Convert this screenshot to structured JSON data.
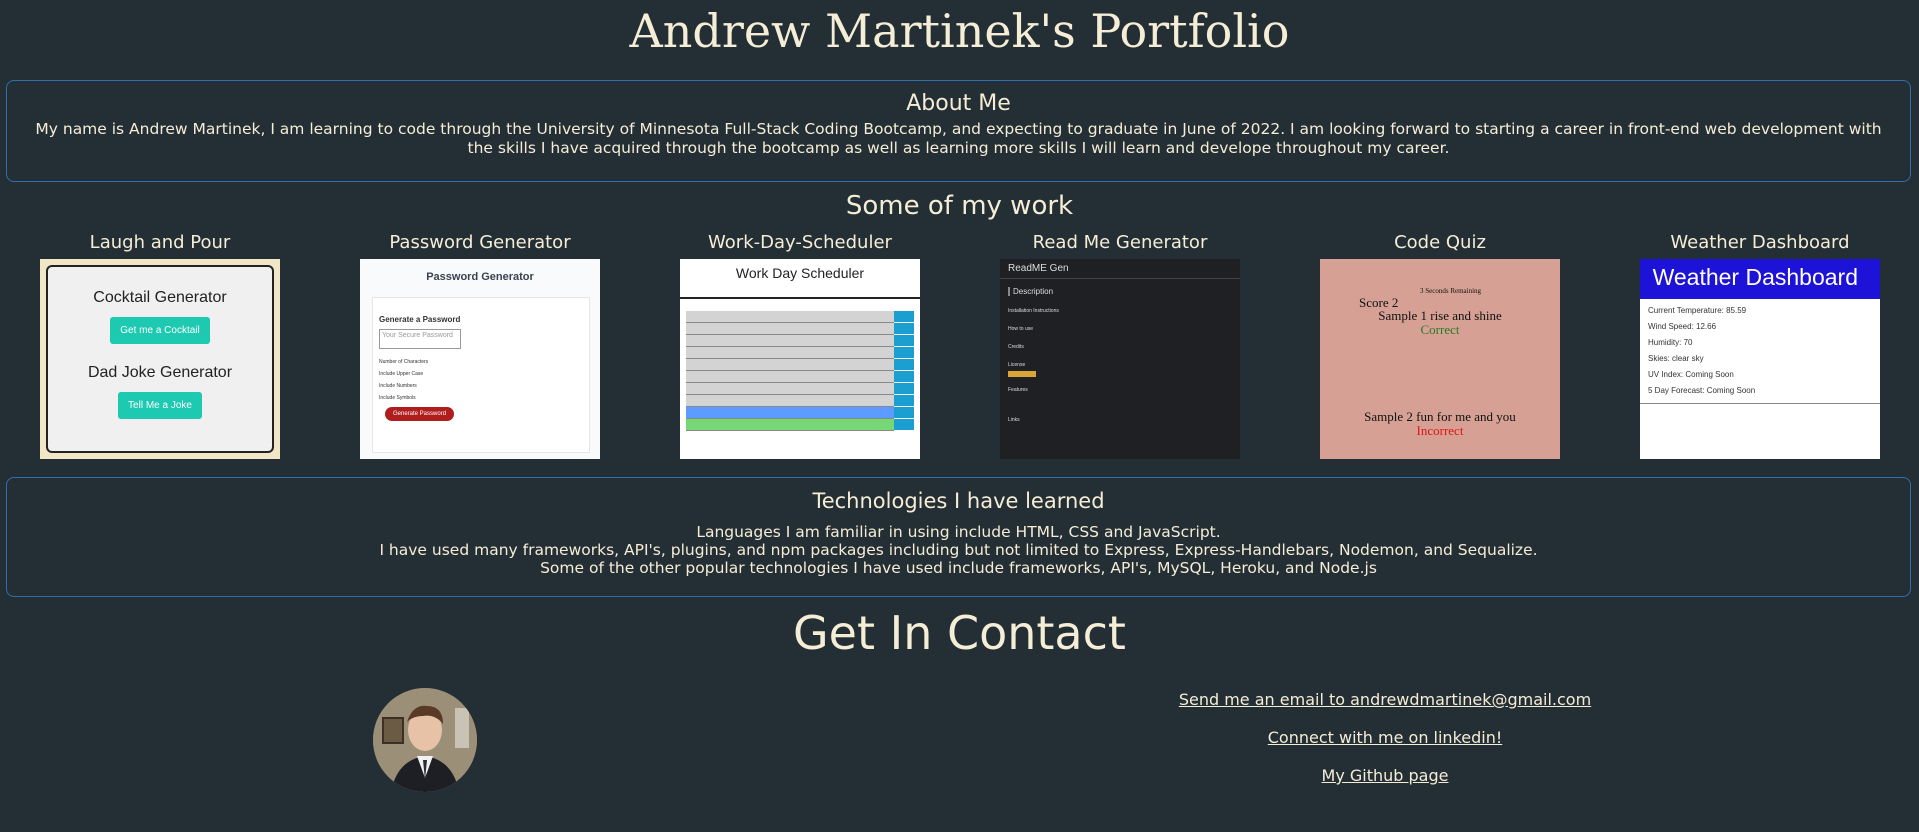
{
  "header": {
    "title": "Andrew Martinek's Portfolio"
  },
  "about": {
    "heading": "About Me",
    "text": "My name is Andrew Martinek, I am learning to code through the University of Minnesota Full-Stack Coding Bootcamp, and expecting to graduate in June of 2022. I am looking forward to starting a career in front-end web development with the skills I have acquired through the bootcamp as well as learning more skills I will learn and develope throughout my career."
  },
  "work": {
    "heading": "Some of my work",
    "projects": [
      {
        "title": "Laugh and Pour",
        "thumb": {
          "h1": "Cocktail Generator",
          "b1": "Get me a Cocktail",
          "h2": "Dad Joke Generator",
          "b2": "Tell Me a Joke"
        }
      },
      {
        "title": "Password Generator",
        "thumb": {
          "h": "Password Generator",
          "sub": "Generate a Password",
          "placeholder": "Your Secure Password",
          "l1": "Number of Characters",
          "l2": "Include Upper Case",
          "l3": "Include Numbers",
          "l4": "Include Symbols",
          "btn": "Generate Password"
        }
      },
      {
        "title": "Work-Day-Scheduler",
        "thumb": {
          "h": "Work Day Scheduler"
        }
      },
      {
        "title": "Read Me Generator",
        "thumb": {
          "h": "ReadME Gen",
          "s1": "Description",
          "s2": "Installation Instructions",
          "s3": "How to use",
          "s4": "Credits",
          "s5": "License",
          "s6": "Features",
          "s7": "Links"
        }
      },
      {
        "title": "Code Quiz",
        "thumb": {
          "timer": "3 Seconds Remaining",
          "score": "Score 2",
          "q1": "Sample 1 rise and shine",
          "r1": "Correct",
          "q2": "Sample 2 fun for me and you",
          "r2": "Incorrect"
        }
      },
      {
        "title": "Weather Dashboard",
        "thumb": {
          "h": "Weather Dashboard",
          "lines": [
            "Current Temperature: 85.59",
            "Wind Speed: 12.66",
            "Humidity: 70",
            "Skies: clear sky",
            "UV Index: Coming Soon",
            "5 Day Forecast: Coming Soon"
          ]
        }
      }
    ]
  },
  "tech": {
    "heading": "Technologies I have learned",
    "lines": [
      "Languages I am familiar in using include HTML, CSS and JavaScript.",
      "I have used many frameworks, API's, plugins, and npm packages including but not limited to Express, Express-Handlebars, Nodemon, and Sequalize.",
      "Some of the other popular technologies I have used include frameworks, API's, MySQL, Heroku, and Node.js"
    ]
  },
  "contact": {
    "heading": "Get In Contact",
    "email_link": "Send me an email to andrewdmartinek@gmail.com",
    "linkedin_link": "Connect with me on linkedin!",
    "github_link": "My Github page"
  },
  "colors": {
    "background": "#242e35",
    "text": "#f5edd6",
    "border": "#2f6fb0"
  }
}
